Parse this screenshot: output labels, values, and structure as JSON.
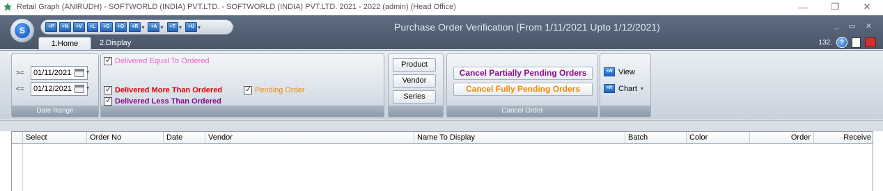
{
  "os_window": {
    "title": "Retail Graph (ANIRUDH) - SOFTWORLD (INDIA) PVT.LTD. - SOFTWORLD (INDIA) PVT.LTD.  2021 - 2022 (admin) (Head Office)",
    "minimize": "—",
    "restore": "❐",
    "close": "✕"
  },
  "app": {
    "title": "Purchase Order Verification (From 1/11/2021 Upto 1/12/2021)",
    "orb_label": "S",
    "quick_access": [
      {
        "label": "+P"
      },
      {
        "label": "+N"
      },
      {
        "label": "+V"
      },
      {
        "label": "+L"
      },
      {
        "label": "+G"
      },
      {
        "label": "+O"
      },
      {
        "label": "+R"
      },
      {
        "label": "+A"
      },
      {
        "label": "+T"
      },
      {
        "label": "+U"
      }
    ],
    "winctl": {
      "minimize": "_",
      "restore": "▭",
      "close": "✕"
    },
    "tabs": [
      {
        "label": "1.Home",
        "active": true
      },
      {
        "label": "2.Display",
        "active": false
      }
    ],
    "tab_right_text": "132.",
    "help_label": "?"
  },
  "ribbon": {
    "date_range": {
      "caption": "Date Range",
      "from_op": ">=",
      "from_value": "01/11/2021",
      "to_op": "<=",
      "to_value": "01/12/2021"
    },
    "filters": {
      "equal": {
        "label": "Delivered Equal To Ordered",
        "color": "#f062c8",
        "checked": true
      },
      "more": {
        "label": "Delivered More Than Ordered",
        "color": "#e00000",
        "checked": true
      },
      "less": {
        "label": "Delivered Less Than Ordered",
        "color": "#8b0a8b",
        "checked": true
      },
      "pending": {
        "label": "Pending Order",
        "color": "#f28a00",
        "checked": true
      }
    },
    "group_buttons": {
      "product": "Product",
      "vendor": "Vendor",
      "series": "Series"
    },
    "cancel_order": {
      "caption": "Cancel Order",
      "partial": {
        "label": "Cancel Partially Pending Orders",
        "color": "#8b0a8b"
      },
      "full": {
        "label": "Cancel Fully Pending Orders",
        "color": "#f28a00"
      }
    },
    "view_group": {
      "view": {
        "label": "View",
        "icon": "+W"
      },
      "chart": {
        "label": "Chart",
        "icon": "+R"
      }
    }
  },
  "grid": {
    "columns": [
      "Select",
      "Order No",
      "Date",
      "Vendor",
      "Name To Display",
      "Batch",
      "Color",
      "Order",
      "Receive"
    ]
  }
}
